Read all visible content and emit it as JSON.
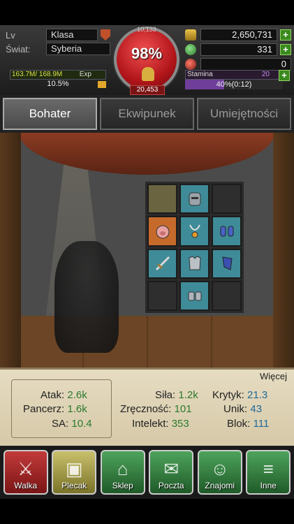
{
  "hud": {
    "level_label": "Lv",
    "class_label": "Klasa",
    "world_label": "Świat:",
    "world_value": "Syberia",
    "orb_top": "10,133",
    "orb_percent": "98%",
    "orb_hp": "20,453",
    "gold": "2,650,731",
    "gems": "331",
    "potions": "0",
    "exp_numbers": "163.7M/ 168.9M",
    "exp_label": "Exp",
    "exp_percent": "10.5%",
    "stamina_label": "Stamina",
    "stamina_numbers": "20",
    "stamina_value": "40%(0:12)"
  },
  "tabs": [
    "Bohater",
    "Ekwipunek",
    "Umiejętności"
  ],
  "stats": {
    "more": "Więcej",
    "atak_label": "Atak:",
    "atak": "2.6k",
    "pancerz_label": "Pancerz:",
    "pancerz": "1.6k",
    "sa_label": "SA:",
    "sa": "10.4",
    "sila_label": "Siła:",
    "sila": "1.2k",
    "zrecznosc_label": "Zręczność:",
    "zrecznosc": "101",
    "intelekt_label": "Intelekt:",
    "intelekt": "353",
    "krytyk_label": "Krytyk:",
    "krytyk": "21.3",
    "unik_label": "Unik:",
    "unik": "43",
    "blok_label": "Blok:",
    "blok": "111"
  },
  "nav": [
    "Walka",
    "Plecak",
    "Sklep",
    "Poczta",
    "Znajomi",
    "Inne"
  ],
  "colors": {
    "accent_red": "#b1151a",
    "stat_green": "#2c7a2e",
    "stat_blue": "#1f6a9a"
  }
}
